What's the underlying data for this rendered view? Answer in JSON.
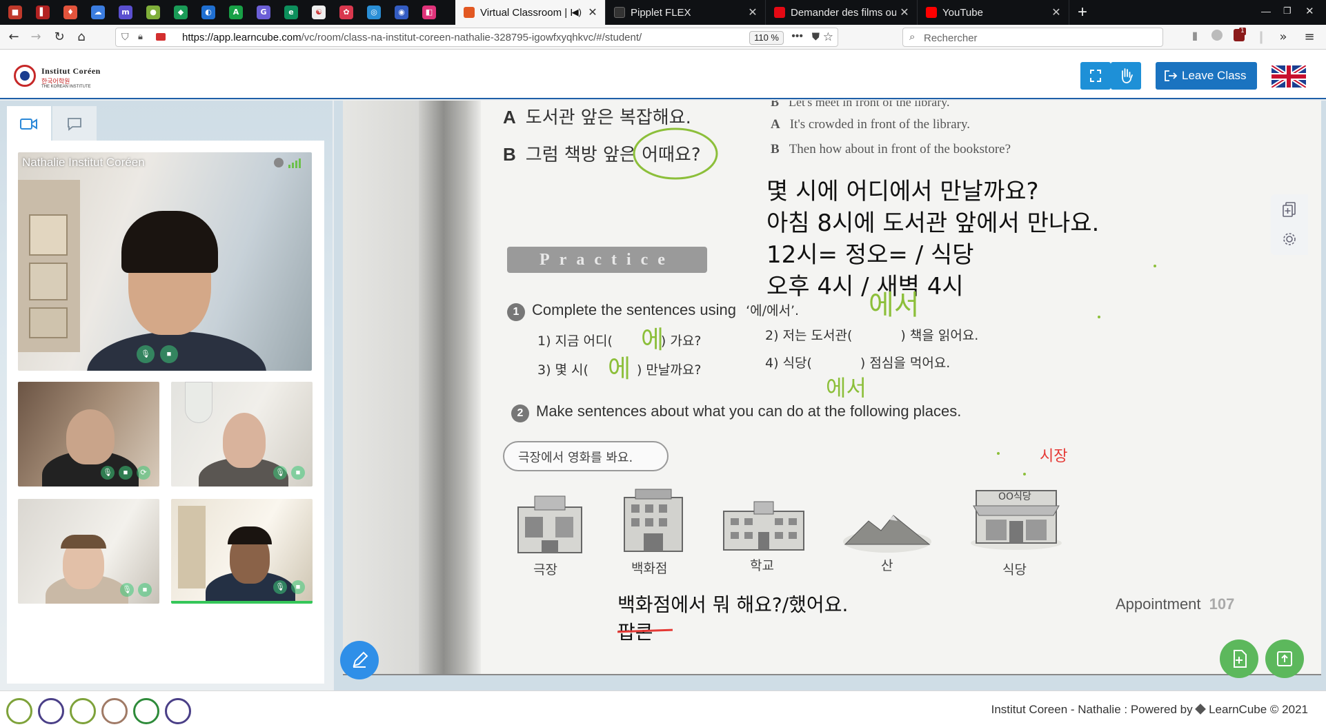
{
  "browser": {
    "tabs": [
      {
        "label": "Virtual Classroom | Le",
        "active": true,
        "favicon_color": "#e25822"
      },
      {
        "label": "Pipplet FLEX",
        "active": false,
        "favicon_color": "#222222"
      },
      {
        "label": "Demander des films ou d",
        "active": false,
        "favicon_color": "#e50914"
      },
      {
        "label": "YouTube",
        "active": false,
        "favicon_color": "#ff0000"
      }
    ],
    "new_tab": "+",
    "url_host": "https://app.learncube.com",
    "url_path": "/vc/room/class-na-institut-coreen-nathalie-328795-igowfxyqhkvc/#/student/",
    "zoom": "110 %",
    "search_placeholder": "Rechercher",
    "badge_count": "1"
  },
  "app": {
    "logo_name": "Institut Coréen",
    "logo_korean": "한국어학원",
    "logo_sub": "THE KOREAN INSTITUTE",
    "leave_label": "Leave Class"
  },
  "participants": {
    "main_name": "Nathalie Institut Coréen"
  },
  "document": {
    "dialog": [
      {
        "speaker": "A",
        "text": "도서관 앞은 복잡해요."
      },
      {
        "speaker": "B",
        "text": "그럼 책방 앞은 어때요?"
      }
    ],
    "english": [
      {
        "speaker": "B",
        "text": "Let's meet in front of the library."
      },
      {
        "speaker": "A",
        "text": "It's crowded in front of the library."
      },
      {
        "speaker": "B",
        "text": "Then how about in front of the bookstore?"
      }
    ],
    "annotations": [
      "몇 시에 어디에서 만날까요?",
      "아침 8시에 도서관 앞에서 만나요.",
      "12시= 정오= / 식당",
      "오후 4시 / 새벽 4시"
    ],
    "practice_title": "Practice",
    "exercise1": {
      "number": "1",
      "instruction": "Complete the sentences using",
      "particle": "‘에/에서’.",
      "items": [
        {
          "left": "1) 지금 어디(",
          "answer": "에",
          "right": ") 가요?"
        },
        {
          "left": "2) 저는 도서관(",
          "answer": "에서",
          "right": ") 책을 읽어요."
        },
        {
          "left": "3) 몇 시(",
          "answer": "에",
          "right": ") 만날까요?"
        },
        {
          "left": "4) 식당(",
          "answer": "에서",
          "right": ") 점심을 먹어요."
        }
      ]
    },
    "exercise2": {
      "number": "2",
      "instruction": "Make sentences about what you can do at the following places."
    },
    "speech_bubble": "극장에서 영화를 봐요.",
    "red_note": "시장",
    "places": [
      "극장",
      "백화점",
      "학교",
      "산",
      "식당"
    ],
    "shop_sign": "OO식당",
    "bottom_line": "백화점에서 뭐 해요?/했어요.",
    "bottom_word": "팝콘",
    "page_footer": "Appointment",
    "page_number": "107"
  },
  "footer": {
    "text": "Institut Coreen - Nathalie :",
    "powered": "Powered by",
    "brand": "LearnCube © 2021"
  },
  "colors": {
    "accent": "#1e90d7",
    "leave": "#1a73c0",
    "handwriting": "#8cbf3a",
    "fab_green": "#5cb85c",
    "edit_blue": "#2f8fe8"
  }
}
